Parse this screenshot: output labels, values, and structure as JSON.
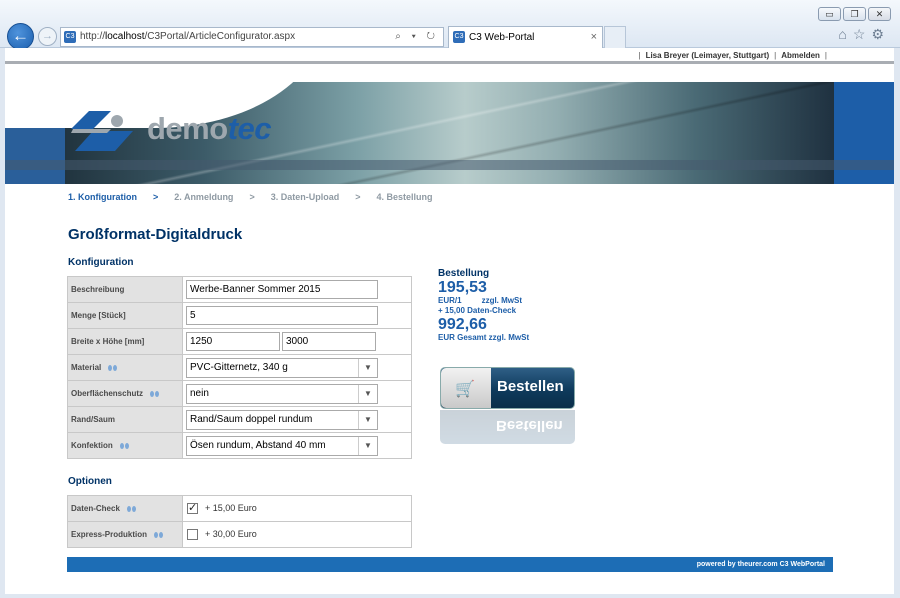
{
  "browser": {
    "url_prefix": "http://",
    "url_host": "localhost",
    "url_path": "/C3Portal/ArticleConfigurator.aspx",
    "tab_title": "C3 Web-Portal",
    "address_tools": "⌕ ▾ ↻",
    "close_glyph": "×"
  },
  "userbar": {
    "user": "Lisa Breyer (Leimayer, Stuttgart)",
    "logout": "Abmelden"
  },
  "logo": {
    "part1": "demo",
    "part2": "tec"
  },
  "steps": [
    {
      "label": "1. Konfiguration",
      "active": true
    },
    {
      "label": "2. Anmeldung"
    },
    {
      "label": "3. Daten-Upload"
    },
    {
      "label": "4. Bestellung"
    }
  ],
  "step_arrow": ">",
  "page_title": "Großformat-Digitaldruck",
  "config": {
    "title": "Konfiguration",
    "rows": {
      "description": {
        "label": "Beschreibung",
        "value": "Werbe-Banner Sommer 2015"
      },
      "quantity": {
        "label": "Menge [Stück]",
        "value": "5"
      },
      "size": {
        "label": "Breite x Höhe [mm]",
        "width": "1250",
        "height": "3000"
      },
      "material": {
        "label": "Material",
        "value": "PVC-Gitternetz, 340 g"
      },
      "surface": {
        "label": "Oberflächenschutz",
        "value": "nein"
      },
      "edge": {
        "label": "Rand/Saum",
        "value": "Rand/Saum doppel rundum"
      },
      "finish": {
        "label": "Konfektion",
        "value": "Ösen rundum, Abstand 40 mm"
      }
    }
  },
  "options": {
    "title": "Optionen",
    "rows": {
      "datacheck": {
        "label": "Daten-Check",
        "checked": true,
        "price": "+ 15,00 Euro"
      },
      "express": {
        "label": "Express-Produktion",
        "checked": false,
        "price": "+ 30,00 Euro"
      }
    }
  },
  "order": {
    "title": "Bestellung",
    "unit_price": "195,53",
    "unit_label": "EUR/1",
    "unit_tax": "zzgl. MwSt",
    "datacheck_line": "+ 15,00 Daten-Check",
    "total": "992,66",
    "total_label": "EUR Gesamt zzgl. MwSt",
    "button_label": "Bestellen"
  },
  "footer": "powered by theurer.com C3 WebPortal",
  "colors": {
    "brand_blue": "#1d5ea8",
    "dark_blue": "#003266",
    "footer_blue": "#1d6db5"
  }
}
